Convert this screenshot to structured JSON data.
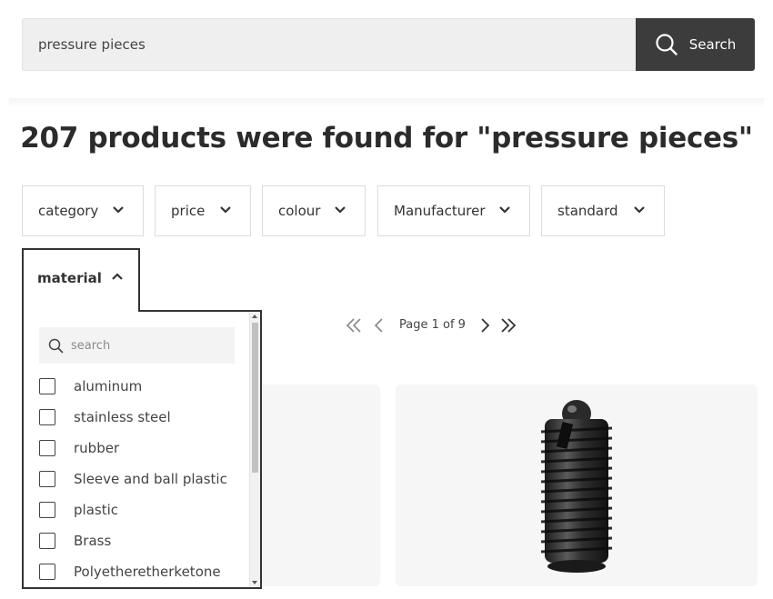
{
  "search": {
    "query": "pressure pieces",
    "button_label": "Search"
  },
  "results": {
    "title": "207 products were found for \"pressure pieces\""
  },
  "filters": [
    {
      "label": "category"
    },
    {
      "label": "price"
    },
    {
      "label": "colour"
    },
    {
      "label": "Manufacturer"
    },
    {
      "label": "standard"
    }
  ],
  "material_filter": {
    "label": "material",
    "search_placeholder": "search",
    "options": [
      {
        "label": "aluminum",
        "checked": false
      },
      {
        "label": "stainless steel",
        "checked": false
      },
      {
        "label": "rubber",
        "checked": false
      },
      {
        "label": "Sleeve and ball plastic",
        "checked": false
      },
      {
        "label": "plastic",
        "checked": false
      },
      {
        "label": "Brass",
        "checked": false
      },
      {
        "label": "Polyetheretherketone",
        "checked": false
      }
    ]
  },
  "pagination": {
    "text": "Page 1 of 9"
  },
  "colors": {
    "button_dark": "#3c3c3c",
    "border_dark": "#333333",
    "card_bg": "#f6f6f6"
  }
}
